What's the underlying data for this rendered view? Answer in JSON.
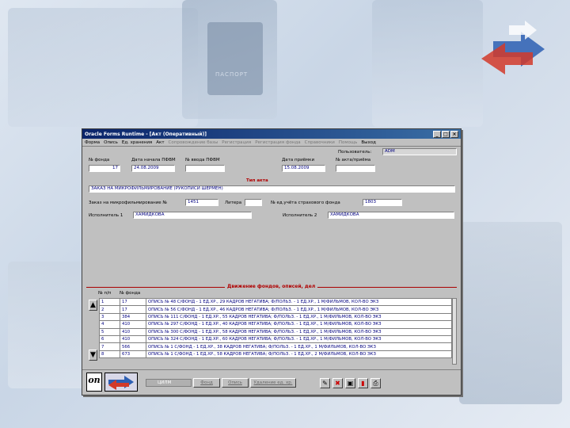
{
  "window": {
    "title": "Oracle Forms Runtime - [Акт (Оперативный)]",
    "controls": [
      "_",
      "□",
      "×"
    ]
  },
  "menu": [
    {
      "label": "Форма",
      "dim": false
    },
    {
      "label": "Опись",
      "dim": false
    },
    {
      "label": "Ед. хранения",
      "dim": false
    },
    {
      "label": "Акт",
      "dim": false
    },
    {
      "label": "Сопровождение базы",
      "dim": true
    },
    {
      "label": "Регистрация",
      "dim": true
    },
    {
      "label": "Регистрация фонда",
      "dim": true
    },
    {
      "label": "Справочники",
      "dim": true
    },
    {
      "label": "Помощь",
      "dim": true
    },
    {
      "label": "Выход",
      "dim": false
    }
  ],
  "form": {
    "user_label": "Пользователь:",
    "user_value": "ADM",
    "fund_no_label": "№ фонда",
    "fund_no_value": "17",
    "date_start_label": "Дата начала ПФВМ",
    "date_start_value": "24.08.2009",
    "fvm_no_label": "№ ввода ПФВМ",
    "fvm_no_value": "",
    "date_end_label": "Дата приёмки",
    "date_end_value": "15.08.2009",
    "act_no_label": "№ акта/приёма",
    "act_no_value": "",
    "act_type_label": "Тип акта",
    "act_type_value": "ЗАКАЗ НА МИКРОФИЛЬМИРОВАНИЕ (РУКОПИСИ ШЕРМЕН)",
    "order_label": "Заказ на микрофильмирование №",
    "order_value": "1451",
    "letter_label": "Литера",
    "letter_value": "",
    "insurance_label": "№ ед.учёта страхового фонда",
    "insurance_value": "1803",
    "executor1_label": "Исполнитель 1",
    "executor1_value": "ХАМИДКОВА",
    "executor2_label": "Исполнитель 2",
    "executor2_value": "ХАМИДКОВА"
  },
  "grid": {
    "title": "Движение фондов, описей, дел",
    "col_no": "№ п/п",
    "col_fund": "№ фонда",
    "rows": [
      {
        "n": "1",
        "fund": "17",
        "text": "ОПИСЬ № 48 С/ФОНД - 1 ЕД.ХР., 29 КАДРОВ НЕГАТИВА; Ф/ПОЛЬЗ. - 1 ЕД.ХР., 1 М/ФИЛЬМОВ, КОЛ-ВО ЭКЗ"
      },
      {
        "n": "2",
        "fund": "17",
        "text": "ОПИСЬ № 56 С/ФОНД - 1 ЕД.ХР., 46 КАДРОВ НЕГАТИВА; Ф/ПОЛЬЗ. - 1 ЕД.ХР., 1 М/ФИЛЬМОВ, КОЛ-ВО ЭКЗ"
      },
      {
        "n": "3",
        "fund": "384",
        "text": "ОПИСЬ № 111 С/ФОНД - 1 ЕД.ХР., 55 КАДРОВ НЕГАТИВА; Ф/ПОЛЬЗ. - 1 ЕД.ХР., 1 М/ФИЛЬМОВ, КОЛ-ВО ЭКЗ"
      },
      {
        "n": "4",
        "fund": "410",
        "text": "ОПИСЬ № 297 С/ФОНД - 1 ЕД.ХР., 40 КАДРОВ НЕГАТИВА; Ф/ПОЛЬЗ. - 1 ЕД.ХР., 1 М/ФИЛЬМОВ, КОЛ-ВО ЭКЗ"
      },
      {
        "n": "5",
        "fund": "410",
        "text": "ОПИСЬ № 300 С/ФОНД - 1 ЕД.ХР., 58 КАДРОВ НЕГАТИВА; Ф/ПОЛЬЗ. - 1 ЕД.ХР., 1 М/ФИЛЬМОВ, КОЛ-ВО ЭКЗ"
      },
      {
        "n": "6",
        "fund": "410",
        "text": "ОПИСЬ № 324 С/ФОНД - 1 ЕД.ХР., 60 КАДРОВ НЕГАТИВА; Ф/ПОЛЬЗ. - 1 ЕД.ХР., 1 М/ФИЛЬМОВ, КОЛ-ВО ЭКЗ"
      },
      {
        "n": "7",
        "fund": "566",
        "text": "ОПИСЬ № 1 С/ФОНД - 1 ЕД.ХР., 38 КАДРОВ НЕГАТИВА; Ф/ПОЛЬЗ. - 1 ЕД.ХР., 1 М/ФИЛЬМОВ, КОЛ-ВО ЭКЗ"
      },
      {
        "n": "8",
        "fund": "673",
        "text": "ОПИСЬ № 1 С/ФОНД - 1 ЕД.ХР., 58 КАДРОВ НЕГАТИВА; Ф/ПОЛЬЗ. - 1 ЕД.ХР., 2 М/ФИЛЬМОВ, КОЛ-ВО ЭКЗ"
      }
    ]
  },
  "bottom": {
    "logo_text": "ЦИЛМ",
    "status_text": "ЦИЛМ",
    "btn_fund": "Фонд",
    "btn_opis": "Опись",
    "btn_units": "Удаление ед. хр."
  },
  "background": {
    "passport_text": "ПАСПОРТ"
  },
  "colors": {
    "title_bar": "#0a246a",
    "accent_red": "#b00000",
    "field_text": "#000080"
  }
}
